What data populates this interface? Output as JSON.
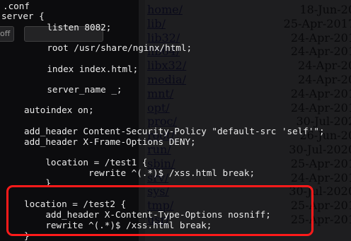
{
  "directory_listing": [
    {
      "name": "home/",
      "date": "18-Jun-20"
    },
    {
      "name": "lib/",
      "date": "25-Apr-2017"
    },
    {
      "name": "lib32/",
      "date": "24-Apr-201"
    },
    {
      "name": "lib64/",
      "date": "24-Apr-201"
    },
    {
      "name": "libx32/",
      "date": "24-Apr-20"
    },
    {
      "name": "media/",
      "date": "24-Apr-20"
    },
    {
      "name": "mnt/",
      "date": "24-Apr-201"
    },
    {
      "name": "opt/",
      "date": "24-Apr-201"
    },
    {
      "name": "proc/",
      "date": "30-Jul-202"
    },
    {
      "name": "root/",
      "date": "26-Jun-20"
    },
    {
      "name": "run/",
      "date": "30-Jul-2020"
    },
    {
      "name": "sbin/",
      "date": "25-Apr-201"
    },
    {
      "name": "srv/",
      "date": "24-Apr-201"
    },
    {
      "name": "sys/",
      "date": "30-Jul-2020"
    },
    {
      "name": "tmp/",
      "date": "25-Apr-201"
    },
    {
      "name": "usr/",
      "date": "25-Apr-201"
    }
  ],
  "toolbar": {
    "left_button_label": "off"
  },
  "code": {
    "line1": ".conf",
    "line2": "server {",
    "line3": "    listen 8082;",
    "line4": "    root /usr/share/nginx/html;",
    "line5": "    index index.html;",
    "line6": "    server_name _;",
    "line7": "autoindex on;",
    "line8": "add_header Content-Security-Policy \"default-src 'self'\";",
    "line9": "add_header X-Frame-Options DENY;",
    "line10": "    location = /test1 {",
    "line11": "            rewrite ^(.*)$ /xss.html break;",
    "line12": "    }",
    "line13": "location = /test2 {",
    "line14": "    add_header X-Content-Type-Options nosniff;",
    "line15": "    rewrite ^(.*)$ /xss.html break;",
    "line16": "}"
  },
  "colors": {
    "highlight": "#ff1a1a",
    "link": "#1a1aa6",
    "terminal_text": "#ececec"
  }
}
